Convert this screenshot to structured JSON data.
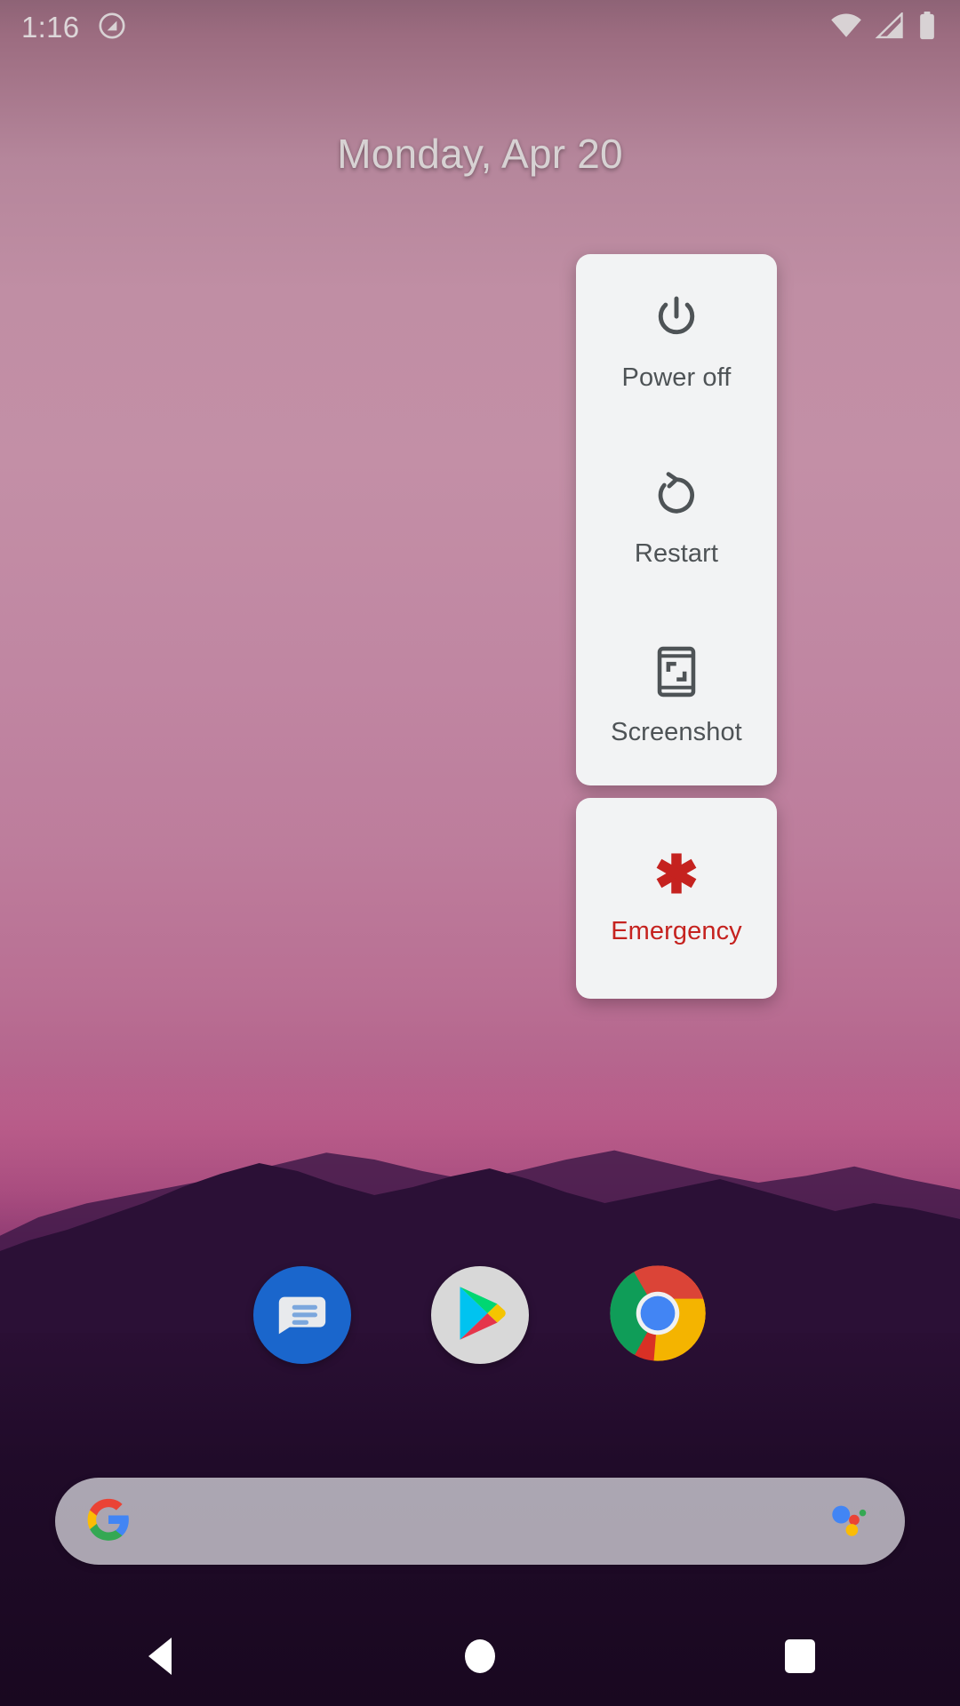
{
  "status_bar": {
    "clock": "1:16",
    "left_icons": [
      {
        "name": "do-not-disturb-icon"
      }
    ],
    "right_icons": [
      {
        "name": "wifi-icon"
      },
      {
        "name": "cellular-signal-icon"
      },
      {
        "name": "battery-full-icon"
      }
    ]
  },
  "home": {
    "date_widget": "Monday, Apr 20"
  },
  "power_menu": {
    "items": [
      {
        "label": "Power off",
        "icon": "power-icon"
      },
      {
        "label": "Restart",
        "icon": "restart-icon"
      },
      {
        "label": "Screenshot",
        "icon": "screenshot-icon"
      }
    ],
    "emergency": {
      "label": "Emergency",
      "icon": "emergency-asterisk-icon"
    },
    "colors": {
      "card_background": "#F2F3F4",
      "label": "#4E5356",
      "emergency": "#C5221F"
    }
  },
  "dock": {
    "apps": [
      {
        "name": "Messages",
        "icon": "messages-icon"
      },
      {
        "name": "Play Store",
        "icon": "play-store-icon"
      },
      {
        "name": "Chrome",
        "icon": "chrome-icon"
      }
    ]
  },
  "search": {
    "value": "",
    "placeholder": "",
    "logo": "google-g-icon",
    "assistant": "google-assistant-icon"
  },
  "nav_bar": {
    "buttons": [
      {
        "name": "Back",
        "icon": "back-triangle-icon"
      },
      {
        "name": "Home",
        "icon": "home-circle-icon"
      },
      {
        "name": "Recents",
        "icon": "recents-square-icon"
      }
    ]
  },
  "wallpaper": {
    "description": "sunset gradient with mountain silhouette",
    "top_color": "#C38FA6",
    "bottom_color": "#190820"
  }
}
